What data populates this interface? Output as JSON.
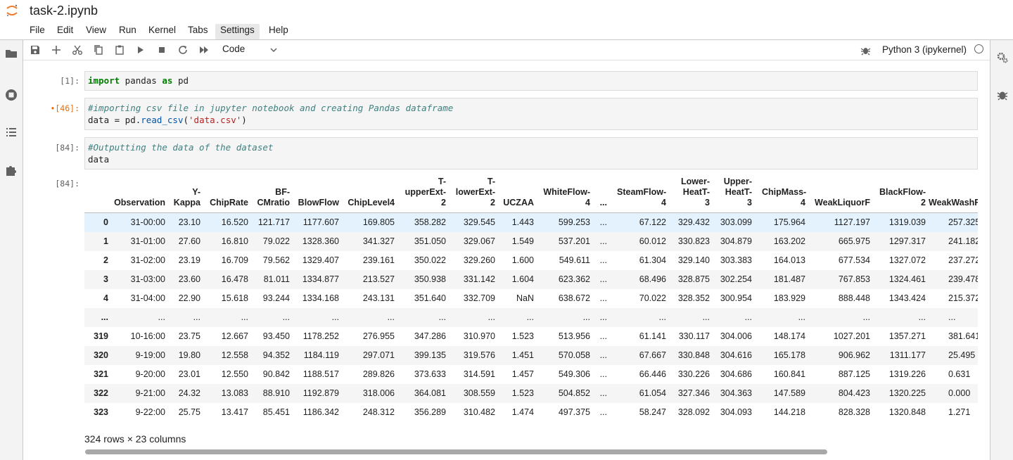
{
  "window": {
    "title": "task-2.ipynb"
  },
  "menu": [
    "File",
    "Edit",
    "View",
    "Run",
    "Kernel",
    "Tabs",
    "Settings",
    "Help"
  ],
  "toolbar": {
    "cell_type": "Code",
    "kernel_name": "Python 3 (ipykernel)"
  },
  "cells": [
    {
      "prompt": "[1]:",
      "lines": [
        "import pandas as pd"
      ]
    },
    {
      "prompt": "•[46]:",
      "lines": [
        "#importing csv file in jupyter notebook and creating Pandas dataframe",
        "data = pd.read_csv('data.csv')"
      ]
    },
    {
      "prompt": "[84]:",
      "lines": [
        "#Outputting the data of the dataset",
        "data"
      ]
    }
  ],
  "output": {
    "prompt": "[84]:",
    "columns": [
      "",
      "Observation",
      "Y-\nKappa",
      "ChipRate",
      "BF-\nCMratio",
      "BlowFlow",
      "ChipLevel4",
      "T-\nupperExt-\n2",
      "T-\nlowerExt-\n2",
      "UCZAA",
      "WhiteFlow-\n4",
      "...",
      "SteamFlow-\n4",
      "Lower-\nHeatT-\n3",
      "Upper-\nHeatT-\n3",
      "ChipMass-\n4",
      "WeakLiquorF",
      "BlackFlow-\n2",
      "WeakWashF"
    ],
    "rows": [
      [
        "0",
        "31-00:00",
        "23.10",
        "16.520",
        "121.717",
        "1177.607",
        "169.805",
        "358.282",
        "329.545",
        "1.443",
        "599.253",
        "...",
        "67.122",
        "329.432",
        "303.099",
        "175.964",
        "1127.197",
        "1319.039",
        "257.325"
      ],
      [
        "1",
        "31-01:00",
        "27.60",
        "16.810",
        "79.022",
        "1328.360",
        "341.327",
        "351.050",
        "329.067",
        "1.549",
        "537.201",
        "...",
        "60.012",
        "330.823",
        "304.879",
        "163.202",
        "665.975",
        "1297.317",
        "241.182"
      ],
      [
        "2",
        "31-02:00",
        "23.19",
        "16.709",
        "79.562",
        "1329.407",
        "239.161",
        "350.022",
        "329.260",
        "1.600",
        "549.611",
        "...",
        "61.304",
        "329.140",
        "303.383",
        "164.013",
        "677.534",
        "1327.072",
        "237.272"
      ],
      [
        "3",
        "31-03:00",
        "23.60",
        "16.478",
        "81.011",
        "1334.877",
        "213.527",
        "350.938",
        "331.142",
        "1.604",
        "623.362",
        "...",
        "68.496",
        "328.875",
        "302.254",
        "181.487",
        "767.853",
        "1324.461",
        "239.478"
      ],
      [
        "4",
        "31-04:00",
        "22.90",
        "15.618",
        "93.244",
        "1334.168",
        "243.131",
        "351.640",
        "332.709",
        "NaN",
        "638.672",
        "...",
        "70.022",
        "328.352",
        "300.954",
        "183.929",
        "888.448",
        "1343.424",
        "215.372"
      ],
      [
        "...",
        "...",
        "...",
        "...",
        "...",
        "...",
        "...",
        "...",
        "...",
        "...",
        "...",
        "...",
        "...",
        "...",
        "...",
        "...",
        "...",
        "...",
        "..."
      ],
      [
        "319",
        "10-16:00",
        "23.75",
        "12.667",
        "93.450",
        "1178.252",
        "276.955",
        "347.286",
        "310.970",
        "1.523",
        "513.956",
        "...",
        "61.141",
        "330.117",
        "304.006",
        "148.174",
        "1027.201",
        "1357.271",
        "381.641"
      ],
      [
        "320",
        "9-19:00",
        "19.80",
        "12.558",
        "94.352",
        "1184.119",
        "297.071",
        "399.135",
        "319.576",
        "1.451",
        "570.058",
        "...",
        "67.667",
        "330.848",
        "304.616",
        "165.178",
        "906.962",
        "1311.177",
        "25.495"
      ],
      [
        "321",
        "9-20:00",
        "23.01",
        "12.550",
        "90.842",
        "1188.517",
        "289.826",
        "373.633",
        "314.591",
        "1.457",
        "549.306",
        "...",
        "66.446",
        "330.226",
        "304.686",
        "160.841",
        "887.125",
        "1319.226",
        "0.631"
      ],
      [
        "322",
        "9-21:00",
        "24.32",
        "13.083",
        "88.910",
        "1192.879",
        "318.006",
        "364.081",
        "308.559",
        "1.523",
        "504.852",
        "...",
        "61.054",
        "327.346",
        "304.363",
        "147.589",
        "804.423",
        "1320.225",
        "0.000"
      ],
      [
        "323",
        "9-22:00",
        "25.75",
        "13.417",
        "85.451",
        "1186.342",
        "248.312",
        "356.289",
        "310.482",
        "1.474",
        "497.375",
        "...",
        "58.247",
        "328.092",
        "304.093",
        "144.218",
        "828.328",
        "1320.848",
        "1.271"
      ]
    ],
    "shape_text": "324 rows × 23 columns"
  }
}
